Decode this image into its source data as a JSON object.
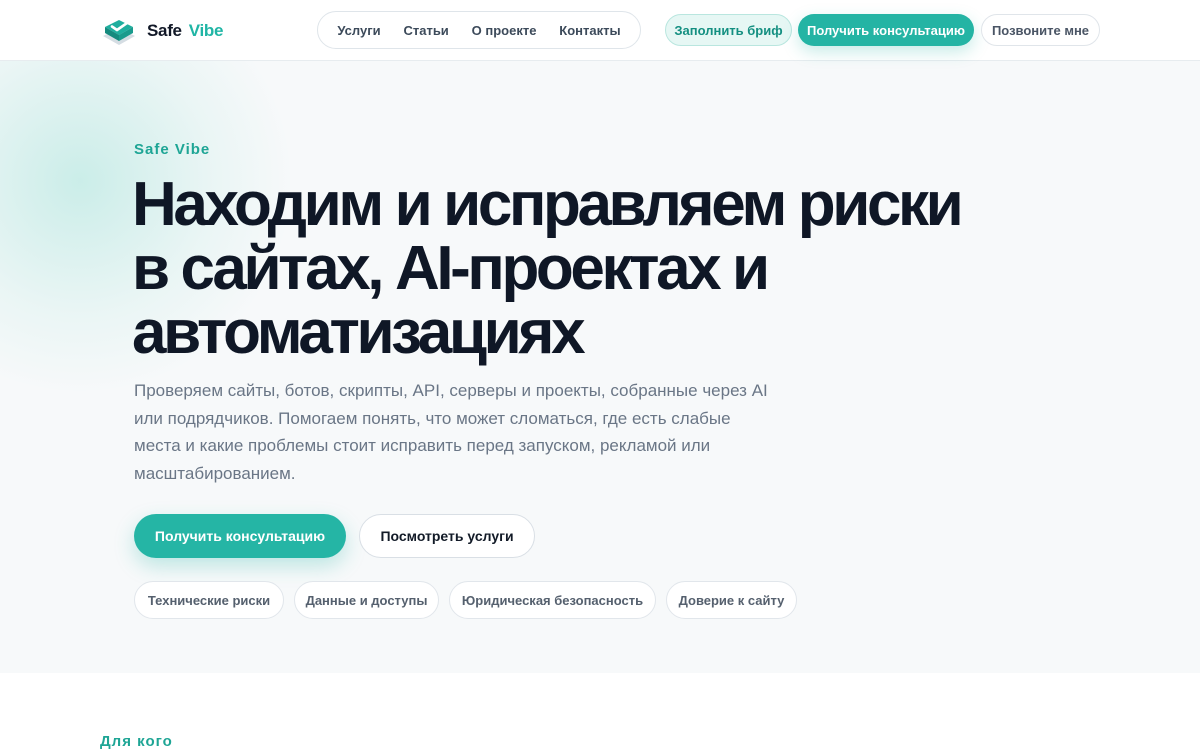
{
  "brand": {
    "name_part1": "Safe",
    "name_part2": "Vibe",
    "accent_color": "#24b4a4",
    "logo_icon": "shield-check-icon"
  },
  "nav": {
    "items": [
      {
        "label": "Услуги"
      },
      {
        "label": "Статьи"
      },
      {
        "label": "О проекте"
      },
      {
        "label": "Контакты"
      }
    ]
  },
  "header_actions": {
    "brief_label": "Заполнить бриф",
    "consult_label": "Получить консультацию",
    "call_label": "Позвоните мне"
  },
  "hero": {
    "eyebrow": "Safe Vibe",
    "title_line1": "Находим и исправляем риски",
    "title_line2": "в сайтах, AI-проектах и",
    "title_line3": "автоматизациях",
    "description": "Проверяем сайты, ботов, скрипты, API, серверы и проекты, собранные через AI или подрядчиков. Помогаем понять, что может сломаться, где есть слабые места и какие проблемы стоит исправить перед запуском, рекламой или масштабированием.",
    "primary_cta": "Получить консультацию",
    "secondary_cta": "Посмотреть услуги",
    "chips": [
      {
        "label": "Технические риски"
      },
      {
        "label": "Данные и доступы"
      },
      {
        "label": "Юридическая безопасность"
      },
      {
        "label": "Доверие к сайту"
      }
    ]
  },
  "for_whom": {
    "title": "Для кого"
  }
}
